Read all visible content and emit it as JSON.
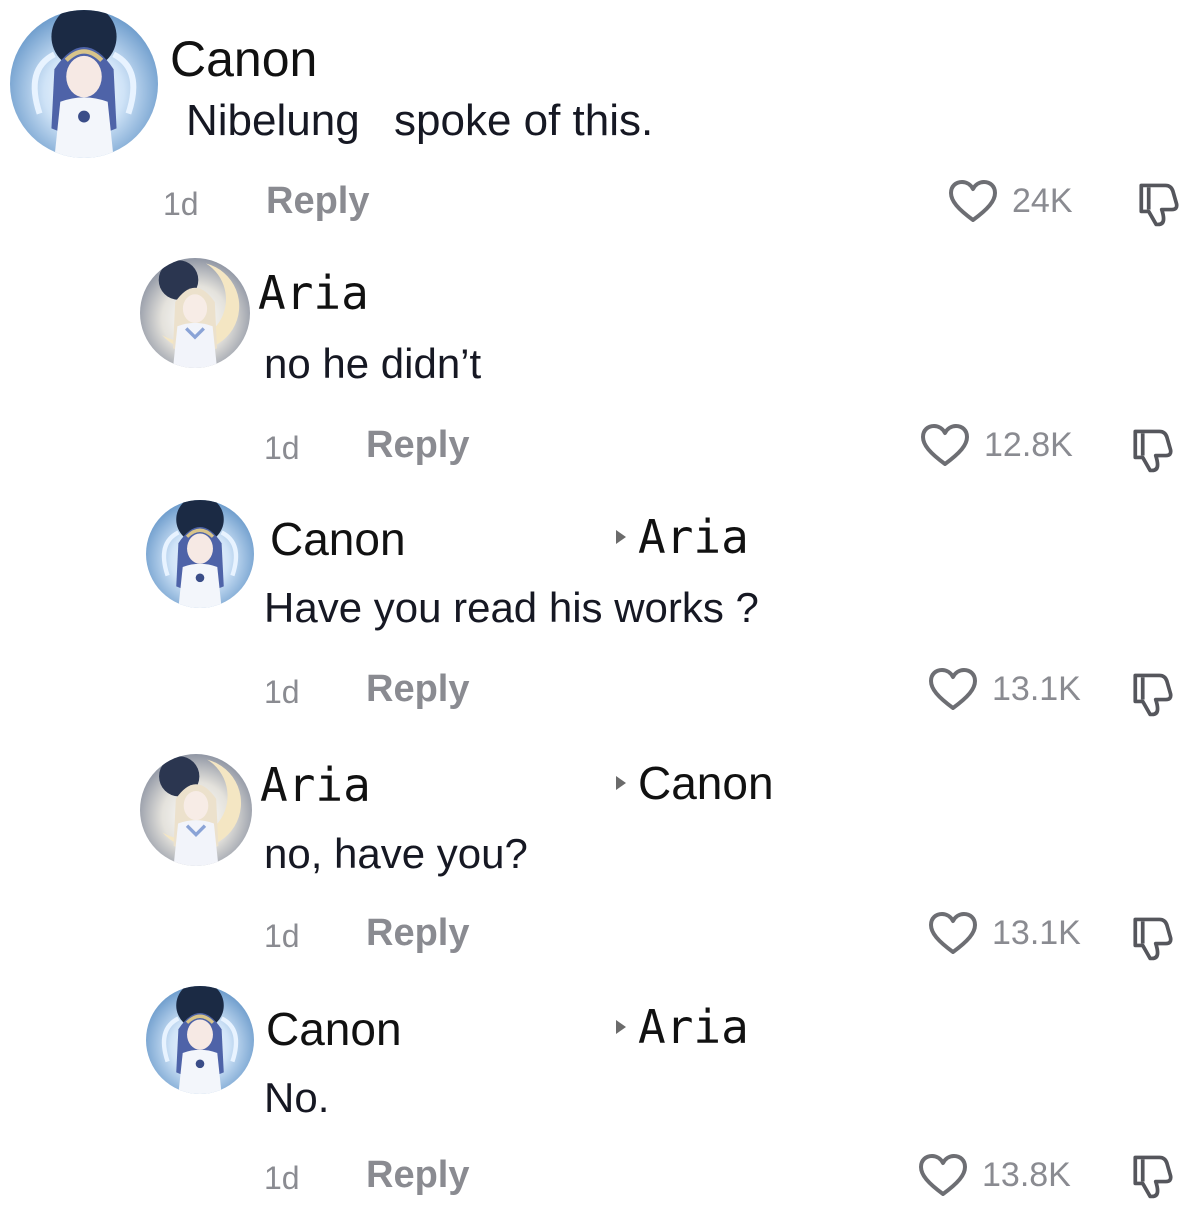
{
  "comments": [
    {
      "author": "Canon",
      "text_parts": [
        "Nibelung",
        "spoke of this."
      ],
      "time": "1d",
      "reply_label": "Reply",
      "likes": "24K",
      "avatar": "canon-avatar"
    },
    {
      "author": "Aria",
      "text": "no he didn’t",
      "time": "1d",
      "reply_label": "Reply",
      "likes": "12.8K",
      "avatar": "aria-avatar"
    },
    {
      "author": "Canon",
      "reply_to": "Aria",
      "text": "Have you read his works ?",
      "time": "1d",
      "reply_label": "Reply",
      "likes": "13.1K",
      "avatar": "canon-avatar"
    },
    {
      "author": "Aria",
      "reply_to": "Canon",
      "text": "no, have you?",
      "time": "1d",
      "reply_label": "Reply",
      "likes": "13.1K",
      "avatar": "aria-avatar"
    },
    {
      "author": "Canon",
      "reply_to": "Aria",
      "text": "No.",
      "time": "1d",
      "reply_label": "Reply",
      "likes": "13.8K",
      "avatar": "canon-avatar"
    }
  ],
  "icons": {
    "like": "heart-outline-icon",
    "dislike": "thumbs-down-icon",
    "reply_indicator": "play-triangle-icon"
  },
  "colors": {
    "muted_text": "#8a8b91",
    "primary_text": "#161823",
    "canon_avatar_bg": "#9fc3e6",
    "aria_avatar_bg": "#c9cdd8"
  }
}
